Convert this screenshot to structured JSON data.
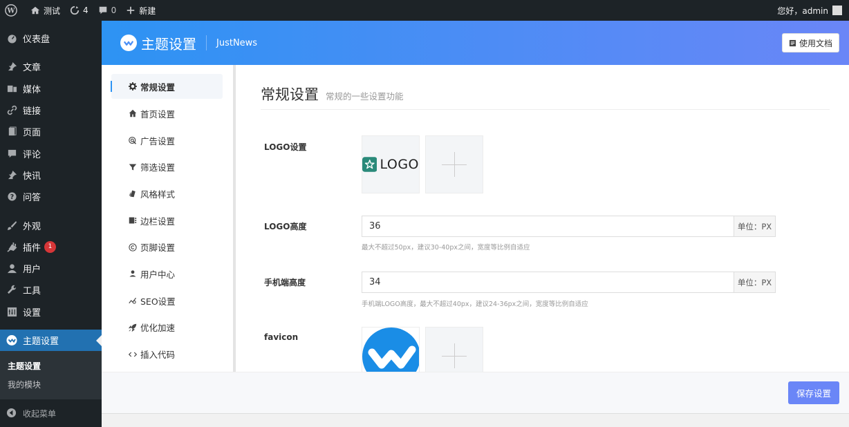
{
  "admin_bar": {
    "site_name": "测试",
    "updates_count": "4",
    "comments_count": "0",
    "new_label": "新建",
    "greeting": "您好，admin"
  },
  "wp_menu": {
    "items": [
      {
        "label": "仪表盘",
        "icon": "dashboard-icon"
      },
      {
        "label": "文章",
        "icon": "pin-icon"
      },
      {
        "label": "媒体",
        "icon": "media-icon"
      },
      {
        "label": "链接",
        "icon": "link-icon"
      },
      {
        "label": "页面",
        "icon": "page-icon"
      },
      {
        "label": "评论",
        "icon": "comment-icon"
      },
      {
        "label": "快讯",
        "icon": "pin-icon"
      },
      {
        "label": "问答",
        "icon": "question-icon"
      },
      {
        "label": "外观",
        "icon": "brush-icon"
      },
      {
        "label": "插件",
        "icon": "plugin-icon",
        "badge": "1"
      },
      {
        "label": "用户",
        "icon": "user-icon"
      },
      {
        "label": "工具",
        "icon": "wrench-icon"
      },
      {
        "label": "设置",
        "icon": "settings-icon"
      },
      {
        "label": "主题设置",
        "icon": "theme-logo-icon"
      }
    ],
    "submenu": [
      "主题设置",
      "我的模块"
    ],
    "collapse_label": "收起菜单"
  },
  "panel": {
    "title": "主题设置",
    "theme_name": "JustNews",
    "doc_button": "使用文档",
    "tabs": [
      {
        "label": "常规设置",
        "icon": "gear-icon"
      },
      {
        "label": "首页设置",
        "icon": "home-icon"
      },
      {
        "label": "广告设置",
        "icon": "ad-icon"
      },
      {
        "label": "筛选设置",
        "icon": "filter-icon"
      },
      {
        "label": "风格样式",
        "icon": "style-icon"
      },
      {
        "label": "边栏设置",
        "icon": "sidebar-icon"
      },
      {
        "label": "页脚设置",
        "icon": "copyright-icon"
      },
      {
        "label": "用户中心",
        "icon": "user-icon"
      },
      {
        "label": "SEO设置",
        "icon": "seo-icon"
      },
      {
        "label": "优化加速",
        "icon": "rocket-icon"
      },
      {
        "label": "插入代码",
        "icon": "code-icon"
      }
    ],
    "section_title": "常规设置",
    "section_desc": "常规的一些设置功能",
    "fields": {
      "logo_label": "LOGO设置",
      "logo_text": "LOGO",
      "logo_height_label": "LOGO高度",
      "logo_height_value": "36",
      "logo_height_unit": "单位：PX",
      "logo_height_hint": "最大不超过50px，建议30-40px之间，宽度等比例自适应",
      "mobile_height_label": "手机端高度",
      "mobile_height_value": "34",
      "mobile_height_unit": "单位：PX",
      "mobile_height_hint": "手机端LOGO高度，最大不超过40px，建议24-36px之间，宽度等比例自适应",
      "favicon_label": "favicon"
    },
    "save_button": "保存设置"
  },
  "colors": {
    "admin_dark": "#1d2327",
    "wp_blue": "#2271b1",
    "header_gradient_start": "#2d93f3",
    "header_gradient_end": "#6a86f7",
    "save_button": "#6a86f7",
    "badge_red": "#d63638",
    "logo_green": "#2a8a7a"
  }
}
